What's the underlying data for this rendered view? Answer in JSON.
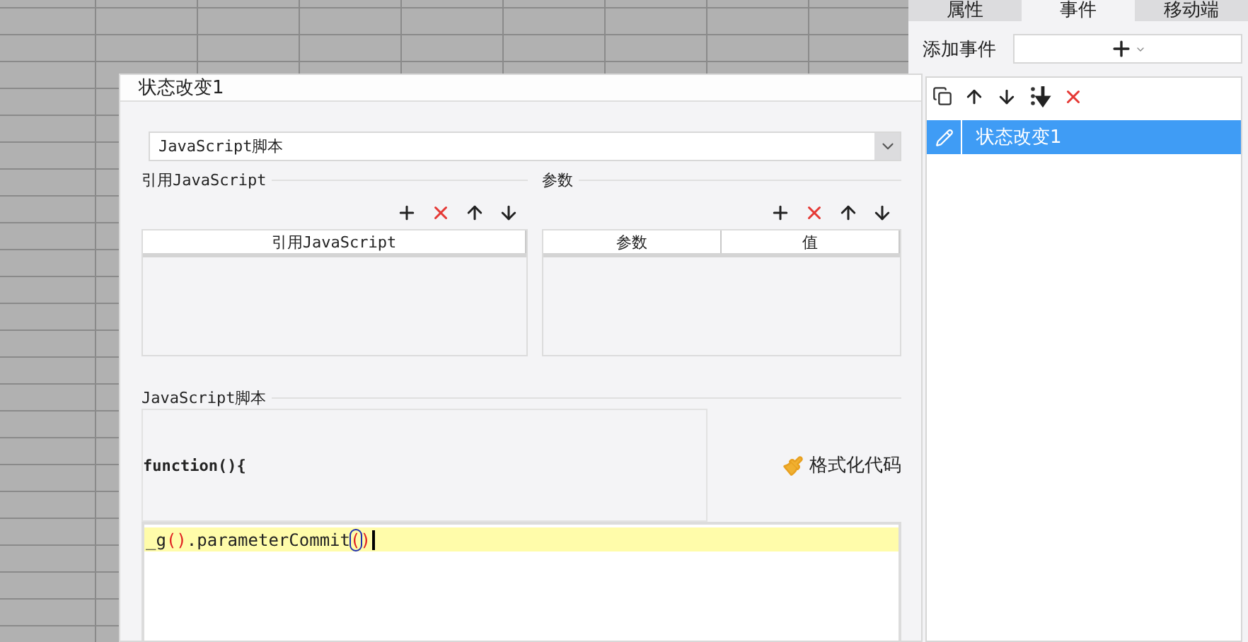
{
  "panel_tabs": [
    {
      "label": "属性",
      "selected": false
    },
    {
      "label": "事件",
      "selected": true
    },
    {
      "label": "移动端",
      "selected": false
    }
  ],
  "add_event": {
    "label": "添加事件"
  },
  "events": [
    {
      "name": "状态改变1",
      "selected": true
    }
  ],
  "dialog": {
    "title": "状态改变1",
    "type_select": {
      "value": "JavaScript脚本"
    },
    "references": {
      "title": "引用JavaScript",
      "columns": [
        "引用JavaScript"
      ]
    },
    "parameters": {
      "title": "参数",
      "columns": [
        "参数",
        "值"
      ]
    },
    "script": {
      "title": "JavaScript脚本",
      "header": "function(){",
      "format_button": "格式化代码",
      "lines": [
        {
          "current": true,
          "tokens": [
            {
              "text": "_g",
              "kind": "plain"
            },
            {
              "text": "()",
              "kind": "bracket"
            },
            {
              "text": ".parameterCommit",
              "kind": "plain"
            },
            {
              "text": "(",
              "kind": "matched"
            },
            {
              "text": ")",
              "kind": "bracket"
            }
          ]
        }
      ]
    }
  }
}
